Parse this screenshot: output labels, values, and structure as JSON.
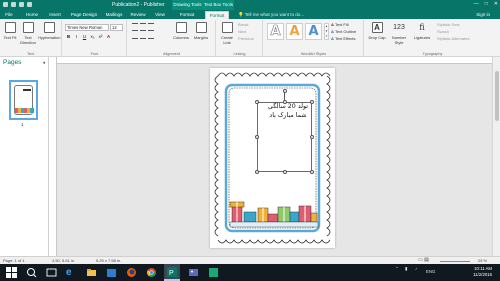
{
  "titlebar": {
    "title": "Publication2 - Publisher",
    "context_tabs": [
      "Drawing Tools",
      "Text Box Tools"
    ],
    "window_buttons": [
      "—",
      "□",
      "✕"
    ]
  },
  "tabs": [
    "File",
    "Home",
    "Insert",
    "Page Design",
    "Mailings",
    "Review",
    "View",
    "Format",
    "Format"
  ],
  "tell_me": "Tell me what you want to do...",
  "sign_in": "Sign in",
  "ribbon": {
    "text_group": {
      "name": "Text",
      "text_fit": "Text Fit",
      "text_direction": "Text Direction",
      "hyphenation": "Hyphenation"
    },
    "font_group": {
      "name": "Font",
      "font_name": "Times New Roman",
      "font_size": "12"
    },
    "alignment_group": {
      "name": "Alignment",
      "columns": "Columns",
      "margins": "Margins"
    },
    "linking_group": {
      "name": "Linking",
      "create_link": "Create Link",
      "break": "Break",
      "next": "Next",
      "previous": "Previous"
    },
    "wordart_group": {
      "name": "WordArt Styles",
      "letter": "A",
      "text_fill": "Text Fill",
      "text_outline": "Text Outline",
      "text_effects": "Text Effects"
    },
    "typography_group": {
      "name": "Typography",
      "drop_cap": "Drop Cap",
      "number_style": "Number Style",
      "ligatures": "Ligatures",
      "stylistic_sets": "Stylistic Sets",
      "swash": "Swash",
      "stylistic_alternates": "Stylistic Alternates",
      "number_style_glyph": "123",
      "ligature_glyph": "fi"
    }
  },
  "pages_pane": {
    "title": "Pages",
    "page_number": "1"
  },
  "document": {
    "textbox_lines": [
      "تولد 20 سالگی",
      "شما مبارک باد"
    ]
  },
  "statusbar": {
    "page": "Page: 1 of 1",
    "position": "4.50, 5.61 in.",
    "size": "5.29 x 7.58 in.",
    "zoom": "25 %"
  },
  "taskbar": {
    "language": "ENG",
    "time": "10:11 AM",
    "date": "11/2/2016"
  },
  "colors": {
    "accent": "#077568",
    "wordart_orange": "#f0a23a",
    "wordart_blue": "#4f8fcf",
    "frame_blue": "#5aa9d6"
  }
}
